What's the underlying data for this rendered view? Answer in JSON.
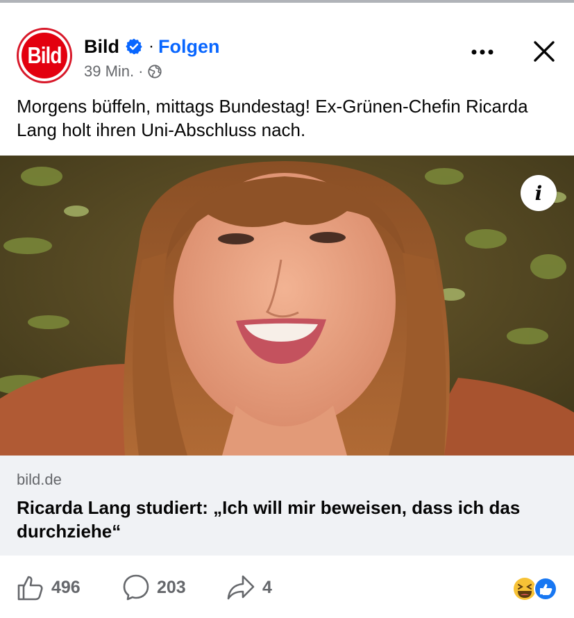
{
  "post": {
    "page_name": "Bild",
    "avatar_text": "Bild",
    "separator": "·",
    "follow_label": "Folgen",
    "time": "39 Min.",
    "meta_separator": "·",
    "text": "Morgens büffeln, mittags Bundestag! Ex-Grünen-Chefin Ricarda Lang holt ihren Uni-Abschluss nach.",
    "icons": {
      "verified": "verified-badge-icon",
      "audience": "globe-icon",
      "more": "more-options-icon",
      "close": "close-icon",
      "info": "info-icon"
    },
    "info_label": "i"
  },
  "link_preview": {
    "domain": "bild.de",
    "headline": "Ricarda Lang studiert: „Ich will mir beweisen, dass ich das durchziehe“"
  },
  "actions": {
    "like_count": "496",
    "comment_count": "203",
    "share_count": "4",
    "reaction_icons": [
      "haha-reaction-icon",
      "like-reaction-icon"
    ]
  },
  "colors": {
    "brand_red": "#e3000f",
    "link_blue": "#0866ff",
    "muted_text": "#65676b",
    "card_bg": "#f0f2f5"
  }
}
